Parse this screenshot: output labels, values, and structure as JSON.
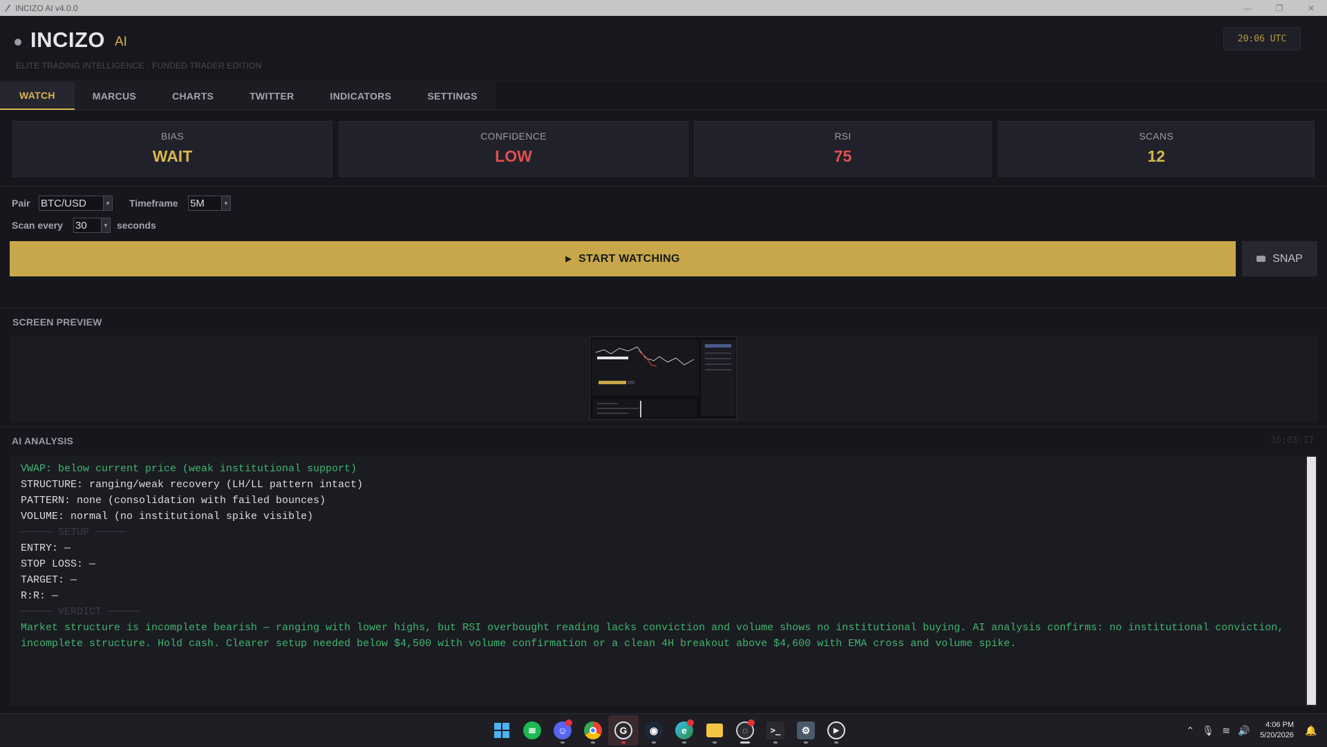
{
  "window": {
    "title": "INCIZO AI  v4.0.0"
  },
  "header": {
    "brand": "INCIZO",
    "brand_suffix": "AI",
    "tagline": "ELITE TRADING INTELLIGENCE  ·  FUNDED TRADER EDITION",
    "clock": "20:06 UTC"
  },
  "tabs": [
    {
      "label": "WATCH",
      "active": true
    },
    {
      "label": "MARCUS"
    },
    {
      "label": "CHARTS"
    },
    {
      "label": "TWITTER"
    },
    {
      "label": "INDICATORS"
    },
    {
      "label": "SETTINGS"
    }
  ],
  "stats": [
    {
      "label": "BIAS",
      "value": "WAIT",
      "color": "#d8b64c"
    },
    {
      "label": "CONFIDENCE",
      "value": "LOW",
      "color": "#e0504e"
    },
    {
      "label": "RSI",
      "value": "75",
      "color": "#e0504e"
    },
    {
      "label": "SCANS",
      "value": "12",
      "color": "#d8b64c"
    }
  ],
  "controls": {
    "pair_label": "Pair",
    "pair_value": "BTC/USD",
    "timeframe_label": "Timeframe",
    "timeframe_value": "5M",
    "scan_label": "Scan every",
    "scan_value": "30",
    "scan_unit": "seconds",
    "start_label": "START WATCHING",
    "snap_label": "SNAP"
  },
  "preview": {
    "title": "SCREEN PREVIEW"
  },
  "analysis": {
    "title": "AI ANALYSIS",
    "timestamp": "16:03:17",
    "lines": [
      "VWAP: below current price (weak institutional support)",
      "STRUCTURE: ranging/weak recovery (LH/LL pattern intact)",
      "PATTERN: none (consolidation with failed bounces)",
      "VOLUME: normal (no institutional spike visible)",
      "───── SETUP ─────",
      "ENTRY: —",
      "STOP LOSS: —",
      "TARGET: —",
      "R:R: —",
      "───── VERDICT ─────"
    ],
    "verdict": "Market structure is incomplete bearish — ranging with lower highs, but RSI overbought reading lacks conviction and volume shows no institutional buying. AI analysis confirms: no institutional conviction, incomplete structure. Hold cash. Clearer setup needed below $4,500 with volume confirmation or a clean 4H breakout above $4,600 with EMA cross and volume spike."
  },
  "taskbar": {
    "icons": [
      "windows-start-icon",
      "spotify-icon",
      "discord-icon",
      "chrome-icon",
      "app-g-icon",
      "steam-icon",
      "edge-icon",
      "file-explorer-icon",
      "incizo-app-icon",
      "terminal-icon",
      "app-settings-icon",
      "media-player-icon"
    ],
    "time": "4:06 PM",
    "date": "5/20/2026"
  }
}
